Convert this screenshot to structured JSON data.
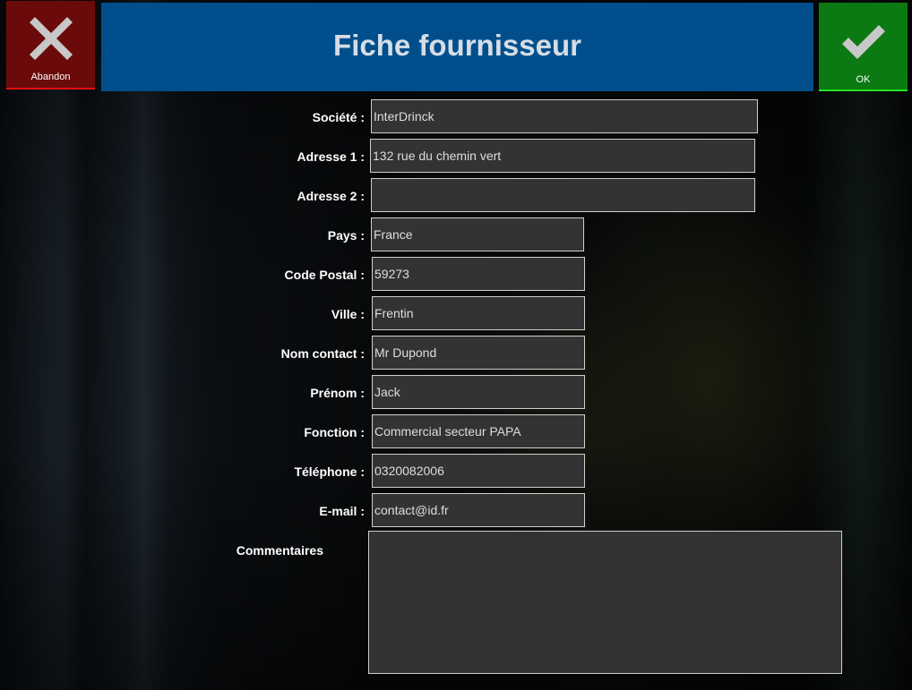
{
  "header": {
    "title": "Fiche fournisseur"
  },
  "actions": {
    "cancel": {
      "label": "Abandon",
      "icon": "close-icon",
      "color": "#6b0a0a",
      "accent": "#e01010"
    },
    "confirm": {
      "label": "OK",
      "icon": "check-icon",
      "color": "#0c7a12",
      "accent": "#22e022"
    }
  },
  "form": {
    "societe": {
      "label": "Société :",
      "value": "InterDrinck"
    },
    "adresse1": {
      "label": "Adresse 1 :",
      "value": "132 rue du chemin vert"
    },
    "adresse2": {
      "label": "Adresse 2 :",
      "value": ""
    },
    "pays": {
      "label": "Pays :",
      "value": "France"
    },
    "code_postal": {
      "label": "Code Postal :",
      "value": "59273"
    },
    "ville": {
      "label": "Ville :",
      "value": "Frentin"
    },
    "nom_contact": {
      "label": "Nom contact :",
      "value": "Mr Dupond"
    },
    "prenom": {
      "label": "Prénom :",
      "value": "Jack"
    },
    "fonction": {
      "label": "Fonction :",
      "value": "Commercial secteur PAPA"
    },
    "telephone": {
      "label": "Téléphone :",
      "value": "0320082006"
    },
    "email": {
      "label": "E-mail :",
      "value": "contact@id.fr"
    },
    "commentaires": {
      "label": "Commentaires",
      "value": ""
    }
  },
  "colors": {
    "header_bg": "#004f8c",
    "field_bg": "#333333",
    "field_border": "#cfcfcf"
  }
}
